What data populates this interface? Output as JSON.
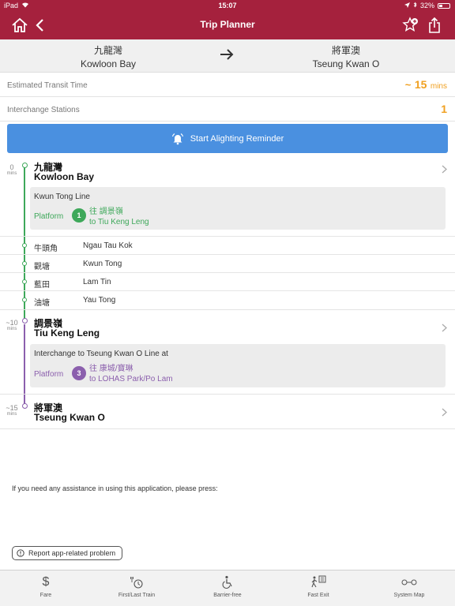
{
  "status_bar": {
    "device": "iPad",
    "time": "15:07",
    "battery": "32%"
  },
  "header": {
    "title": "Trip Planner"
  },
  "route": {
    "from": {
      "zh": "九龍灣",
      "en": "Kowloon Bay"
    },
    "to": {
      "zh": "將軍澳",
      "en": "Tseung Kwan O"
    }
  },
  "transit_time": {
    "label": "Estimated Transit Time",
    "prefix": "~",
    "value": "15",
    "unit": "mins"
  },
  "interchange": {
    "label": "Interchange Stations",
    "value": "1"
  },
  "reminder": {
    "label": "Start Alighting Reminder"
  },
  "colors": {
    "header": "#a5213d",
    "kwun_tong_line": "#3ea85a",
    "tseung_kwan_o_line": "#8b5fad",
    "accent_orange": "#f0a020",
    "reminder_button": "#4a90e0"
  },
  "journey": {
    "start": {
      "mins": "0",
      "mins_unit": "mins",
      "zh": "九龍灣",
      "en": "Kowloon Bay"
    },
    "leg1": {
      "line": "Kwun Tong Line",
      "platform_label": "Platform",
      "platform": "1",
      "dest_zh": "往 調景嶺",
      "dest_en": "to Tiu Keng Leng"
    },
    "intermediate": [
      {
        "zh": "牛頭角",
        "en": "Ngau Tau Kok"
      },
      {
        "zh": "觀塘",
        "en": "Kwun Tong"
      },
      {
        "zh": "藍田",
        "en": "Lam Tin"
      },
      {
        "zh": "油塘",
        "en": "Yau Tong"
      }
    ],
    "interchange_stop": {
      "mins": "~10",
      "mins_unit": "mins",
      "zh": "調景嶺",
      "en": "Tiu Keng Leng"
    },
    "leg2": {
      "line": "Interchange to Tseung Kwan O Line at",
      "platform_label": "Platform",
      "platform": "3",
      "dest_zh": "往 康城/寶琳",
      "dest_en": "to LOHAS Park/Po Lam"
    },
    "end": {
      "mins": "~15",
      "mins_unit": "mins",
      "zh": "將軍澳",
      "en": "Tseung Kwan O"
    }
  },
  "assistance_text": "If you need any assistance in using this application, please press:",
  "report_button": "Report app-related problem",
  "tabs": [
    {
      "label": "Fare",
      "icon": "dollar-icon"
    },
    {
      "label": "First/Last Train",
      "icon": "first-last-train-icon"
    },
    {
      "label": "Barrier-free",
      "icon": "wheelchair-icon"
    },
    {
      "label": "Fast Exit",
      "icon": "fast-exit-icon"
    },
    {
      "label": "System Map",
      "icon": "system-map-icon"
    }
  ]
}
